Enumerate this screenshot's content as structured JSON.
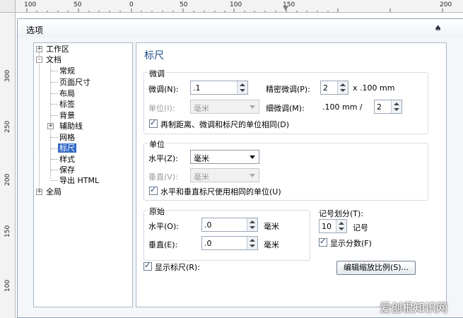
{
  "ruler": {
    "top_labels": [
      "100",
      "50",
      "0",
      "50",
      "100",
      "150",
      "200"
    ],
    "left_labels": [
      "300",
      "250",
      "200",
      "150",
      "100"
    ]
  },
  "dialog": {
    "title": "选项",
    "title_icon": "pin-icon"
  },
  "tree": {
    "items": [
      {
        "label": "工作区",
        "expander": "+"
      },
      {
        "label": "文档",
        "expander": "-"
      },
      {
        "label": "常规"
      },
      {
        "label": "页面尺寸"
      },
      {
        "label": "布局"
      },
      {
        "label": "标签"
      },
      {
        "label": "背景"
      },
      {
        "label": "辅助线",
        "expander": "+"
      },
      {
        "label": "网格"
      },
      {
        "label": "标尺"
      },
      {
        "label": "样式"
      },
      {
        "label": "保存"
      },
      {
        "label": "导出 HTML"
      },
      {
        "label": "全局",
        "expander": "+"
      }
    ]
  },
  "panel": {
    "title": "标尺",
    "nudge": {
      "group_title": "微调",
      "nudge_label": "微调(N):",
      "nudge_value": ".1",
      "precise_label": "精密微调(P):",
      "precise_value": "2",
      "precise_unit": "x .100 mm",
      "units_label": "单位(I):",
      "units_value": "毫米",
      "micro_label": "细微调(M):",
      "micro_prefix": ".100 mm /",
      "micro_value": "2",
      "same_units_label": "再制距离、微调和标尺的单位相同(D)",
      "same_units_checked": true
    },
    "units": {
      "group_title": "单位",
      "horizontal_label": "水平(Z):",
      "horizontal_value": "毫米",
      "vertical_label": "垂直(V):",
      "vertical_value": "毫米",
      "same_label": "水平和垂直标尺使用相同的单位(U)",
      "same_checked": true
    },
    "origin": {
      "group_title": "原始",
      "horizontal_label": "水平(O):",
      "horizontal_value": ".0",
      "horizontal_unit": "毫米",
      "vertical_label": "垂直(E):",
      "vertical_value": ".0",
      "vertical_unit": "毫米"
    },
    "tick": {
      "label": "记号划分(T):",
      "value": "10",
      "unit": "记号",
      "show_fractions_label": "显示分数(F)",
      "show_fractions_checked": true
    },
    "show_rulers_label": "显示标尺(R):",
    "show_rulers_checked": true,
    "edit_scale_button": "编辑缩放比例(S)..."
  },
  "watermark": "爱创根知识网"
}
